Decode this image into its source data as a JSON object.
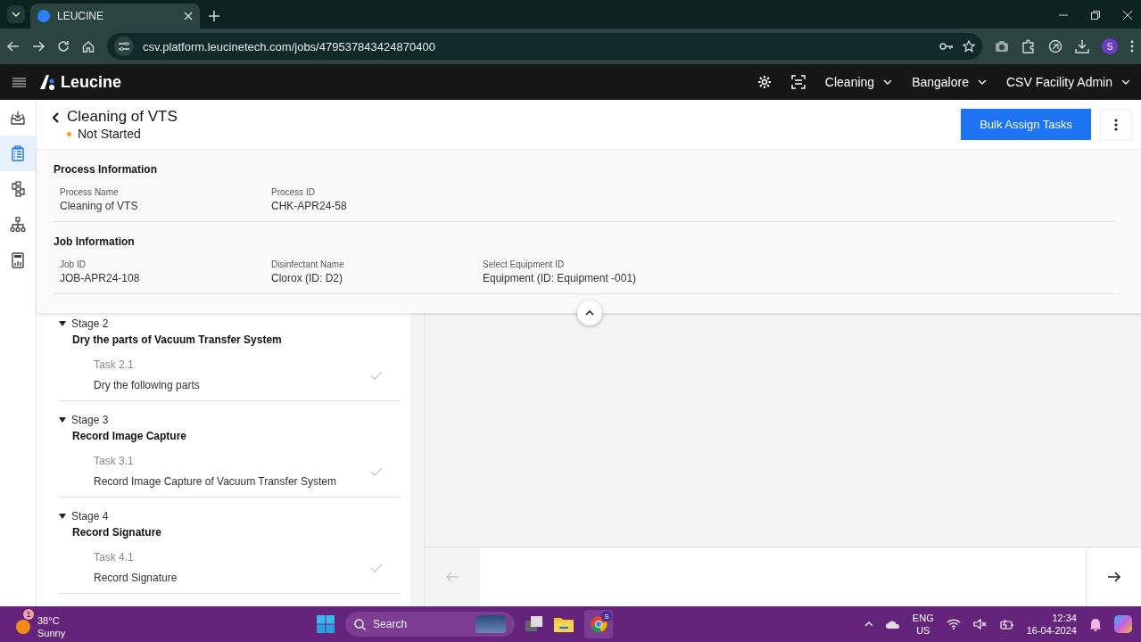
{
  "browser": {
    "tab_title": "LEUCINE",
    "url": "csv.platform.leucinetech.com/jobs/479537843424870400",
    "profile_initial": "S"
  },
  "app_header": {
    "logo": "Leucine",
    "menus": [
      "Cleaning",
      "Bangalore",
      "CSV Facility Admin"
    ]
  },
  "sidebar": {
    "items": [
      {
        "kind": "inbox",
        "selected": false
      },
      {
        "kind": "checklist",
        "selected": true
      },
      {
        "kind": "flow",
        "selected": false
      },
      {
        "kind": "hierarchy",
        "selected": false
      },
      {
        "kind": "reports",
        "selected": false
      }
    ]
  },
  "job": {
    "title": "Cleaning of VTS",
    "status": "Not Started",
    "button": "Bulk Assign Tasks"
  },
  "sections": [
    {
      "title": "Process Information",
      "fields": [
        {
          "label": "Process Name",
          "value": "Cleaning of VTS"
        },
        {
          "label": "Process ID",
          "value": "CHK-APR24-58"
        }
      ]
    },
    {
      "title": "Job Information",
      "fields": [
        {
          "label": "Job ID",
          "value": "JOB-APR24-108"
        },
        {
          "label": "Disinfectant Name",
          "value": "Clorox (ID: D2)"
        },
        {
          "label": "Select Equipment ID",
          "value": "Equipment (ID: Equipment -001)"
        }
      ]
    }
  ],
  "stages": [
    {
      "label": "Stage 2",
      "title": "Dry the parts of Vacuum Transfer System",
      "expanded": true,
      "tasks": [
        {
          "label": "Task 2.1",
          "name": "Dry the following parts",
          "completed": false
        }
      ]
    },
    {
      "label": "Stage 3",
      "title": "Record Image Capture",
      "expanded": true,
      "tasks": [
        {
          "label": "Task 3.1",
          "name": "Record Image Capture of Vacuum Transfer System",
          "completed": false
        }
      ]
    },
    {
      "label": "Stage 4",
      "title": "Record Signature",
      "expanded": true,
      "tasks": [
        {
          "label": "Task 4.1",
          "name": "Record Signature",
          "completed": false
        }
      ]
    }
  ],
  "task_nav": {
    "previous_disabled": true,
    "next_disabled": false
  },
  "taskbar": {
    "weather_badge": "1",
    "temperature": "38°C",
    "condition": "Sunny",
    "search_placeholder": "Search",
    "chrome_badge": "S",
    "language": "ENG",
    "region": "US",
    "time": "12:34",
    "date": "16-04-2024"
  }
}
